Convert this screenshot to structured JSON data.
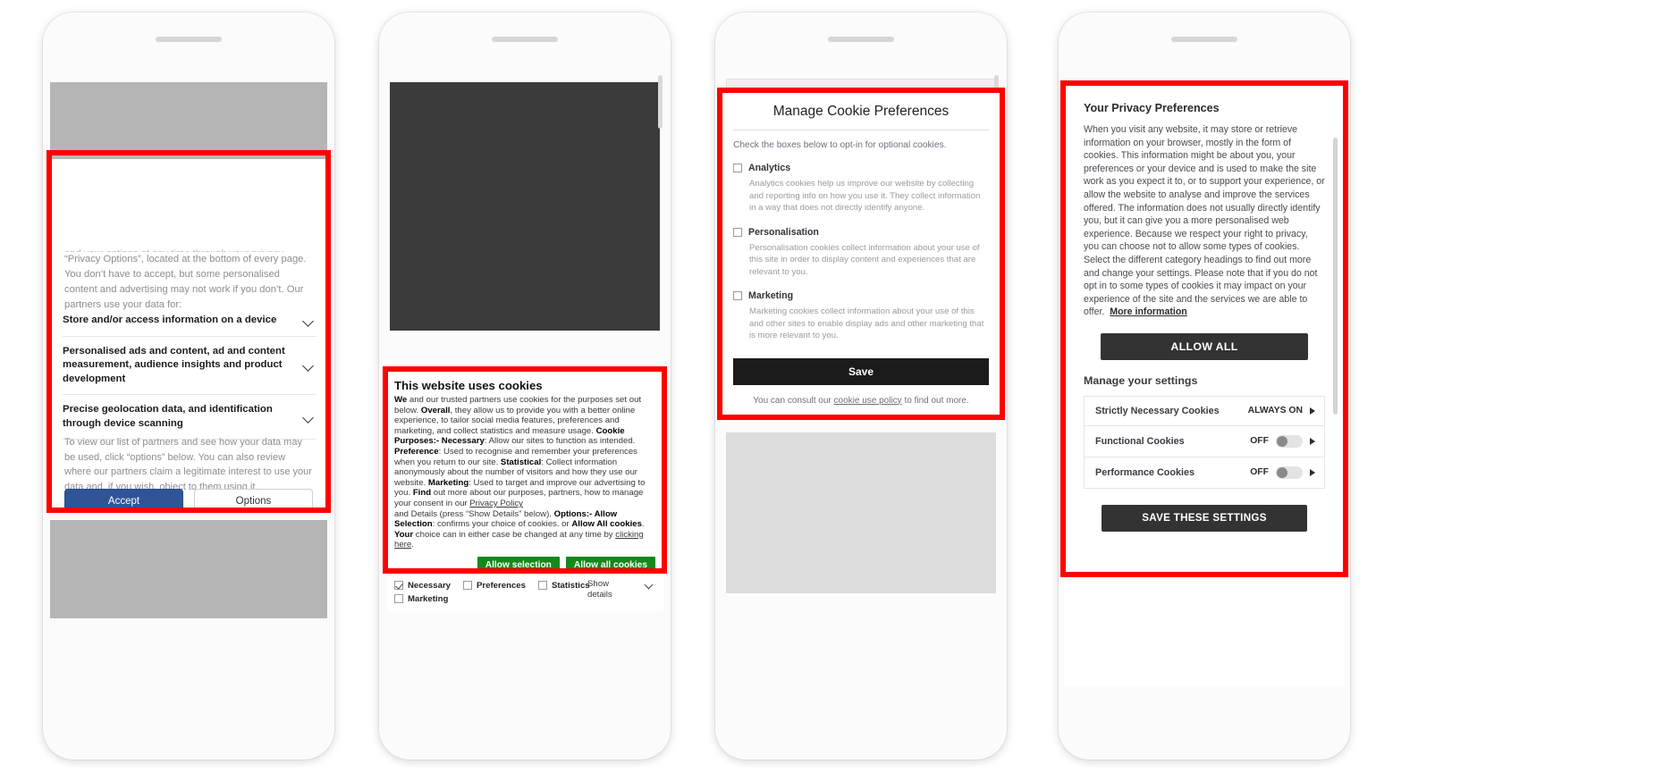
{
  "panels": [
    {
      "id": "panel-1",
      "banner": {
        "intro_clipped": "and your options at any time through your privacy controls in",
        "intro": "“Privacy Options”, located at the bottom of every page. You don’t have to accept, but some personalised content and advertising may not work if you don’t. Our partners use your data for:",
        "purposes": [
          "Store and/or access information on a device",
          "Personalised ads and content, ad and content measurement, audience insights and product development",
          "Precise geolocation data, and identification through device scanning"
        ],
        "note": "To view our list of partners and see how your data may be used, click “options” below. You can also review where our partners claim a legitimate interest to use your data and, if you wish, object to them using it.",
        "accept_label": "Accept",
        "options_label": "Options",
        "accept_color": "#2f5596"
      }
    },
    {
      "id": "panel-2",
      "banner": {
        "title": "This website uses cookies",
        "body_html": "<b>We</b> and our trusted partners use cookies for the purposes set out below. <b>Overall</b>, they allow us to provide you with a better online experience, to tailor social media features, preferences and marketing, and collect statistics and measure usage. <b>Cookie Purposes:- Necessary</b>: Allow our sites to function as intended. <b>Preference</b>: Used to recognise and remember your preferences when you return to our site. <b>Statistical</b>: Collect information anonymously about the number of visitors and how they use our website. <b>Marketing</b>: Used to target and improve our advertising to you. <b>Find</b> out more about our purposes, partners, how to manage your consent in our <a href=\"#\">Privacy Policy</a><br>and Details (press “Show Details” below). <b>Options:- Allow Selection</b>: confirms your choice of cookies. or <b>Allow All cookies</b>. <b>Your</b> choice can in either case be changed at any time by <a href=\"#\">clicking here</a>.",
        "buttons": [
          {
            "label": "Allow selection"
          },
          {
            "label": "Allow all cookies"
          }
        ],
        "button_color": "#12891a",
        "checkboxes": [
          {
            "label": "Necessary",
            "checked": true
          },
          {
            "label": "Preferences",
            "checked": false
          },
          {
            "label": "Statistics",
            "checked": false
          },
          {
            "label": "Marketing",
            "checked": false
          }
        ],
        "show_details_label": "Show details"
      }
    },
    {
      "id": "panel-3",
      "dialog": {
        "title": "Manage Cookie Preferences",
        "subtitle": "Check the boxes below to opt-in for optional cookies.",
        "groups": [
          {
            "name": "Analytics",
            "checked": false,
            "description": "Analytics cookies help us improve our website by collecting and reporting info on how you use it. They collect information in a way that does not directly identify anyone."
          },
          {
            "name": "Personalisation",
            "checked": false,
            "description": "Personalisation cookies collect information about your use of this site in order to display content and experiences that are relevant to you."
          },
          {
            "name": "Marketing",
            "checked": false,
            "description": "Marketing cookies collect information about your use of this and other sites to enable display ads and other marketing that is more relevant to you."
          }
        ],
        "save_label": "Save",
        "footer_prefix": "You can consult our ",
        "footer_link": "cookie use policy",
        "footer_suffix": " to find out more."
      }
    },
    {
      "id": "panel-4",
      "dialog": {
        "title": "Your Privacy Preferences",
        "body": "When you visit any website, it may store or retrieve information on your browser, mostly in the form of cookies. This information might be about you, your preferences or your device and is used to make the site work as you expect it to, or to support your experience, or allow the website to analyse and improve the services offered. The information does not usually directly identify you, but it can give you a more personalised web experience. Because we respect your right to privacy, you can choose not to allow some types of cookies. Select the different category headings to find out more and change your settings. Please note that if you do not opt in to some types of cookies it may impact on your experience of the site and the services we are able to offer.",
        "more_info_label": "More information",
        "allow_all_label": "ALLOW ALL",
        "manage_heading": "Manage your settings",
        "settings": [
          {
            "name": "Strictly Necessary Cookies",
            "state": "ALWAYS ON",
            "has_toggle": false
          },
          {
            "name": "Functional Cookies",
            "state": "OFF",
            "has_toggle": true
          },
          {
            "name": "Performance Cookies",
            "state": "OFF",
            "has_toggle": true
          }
        ],
        "save_label": "SAVE THESE SETTINGS",
        "button_color": "#333333"
      }
    }
  ],
  "annotation": {
    "highlight_color": "#fd0000"
  }
}
